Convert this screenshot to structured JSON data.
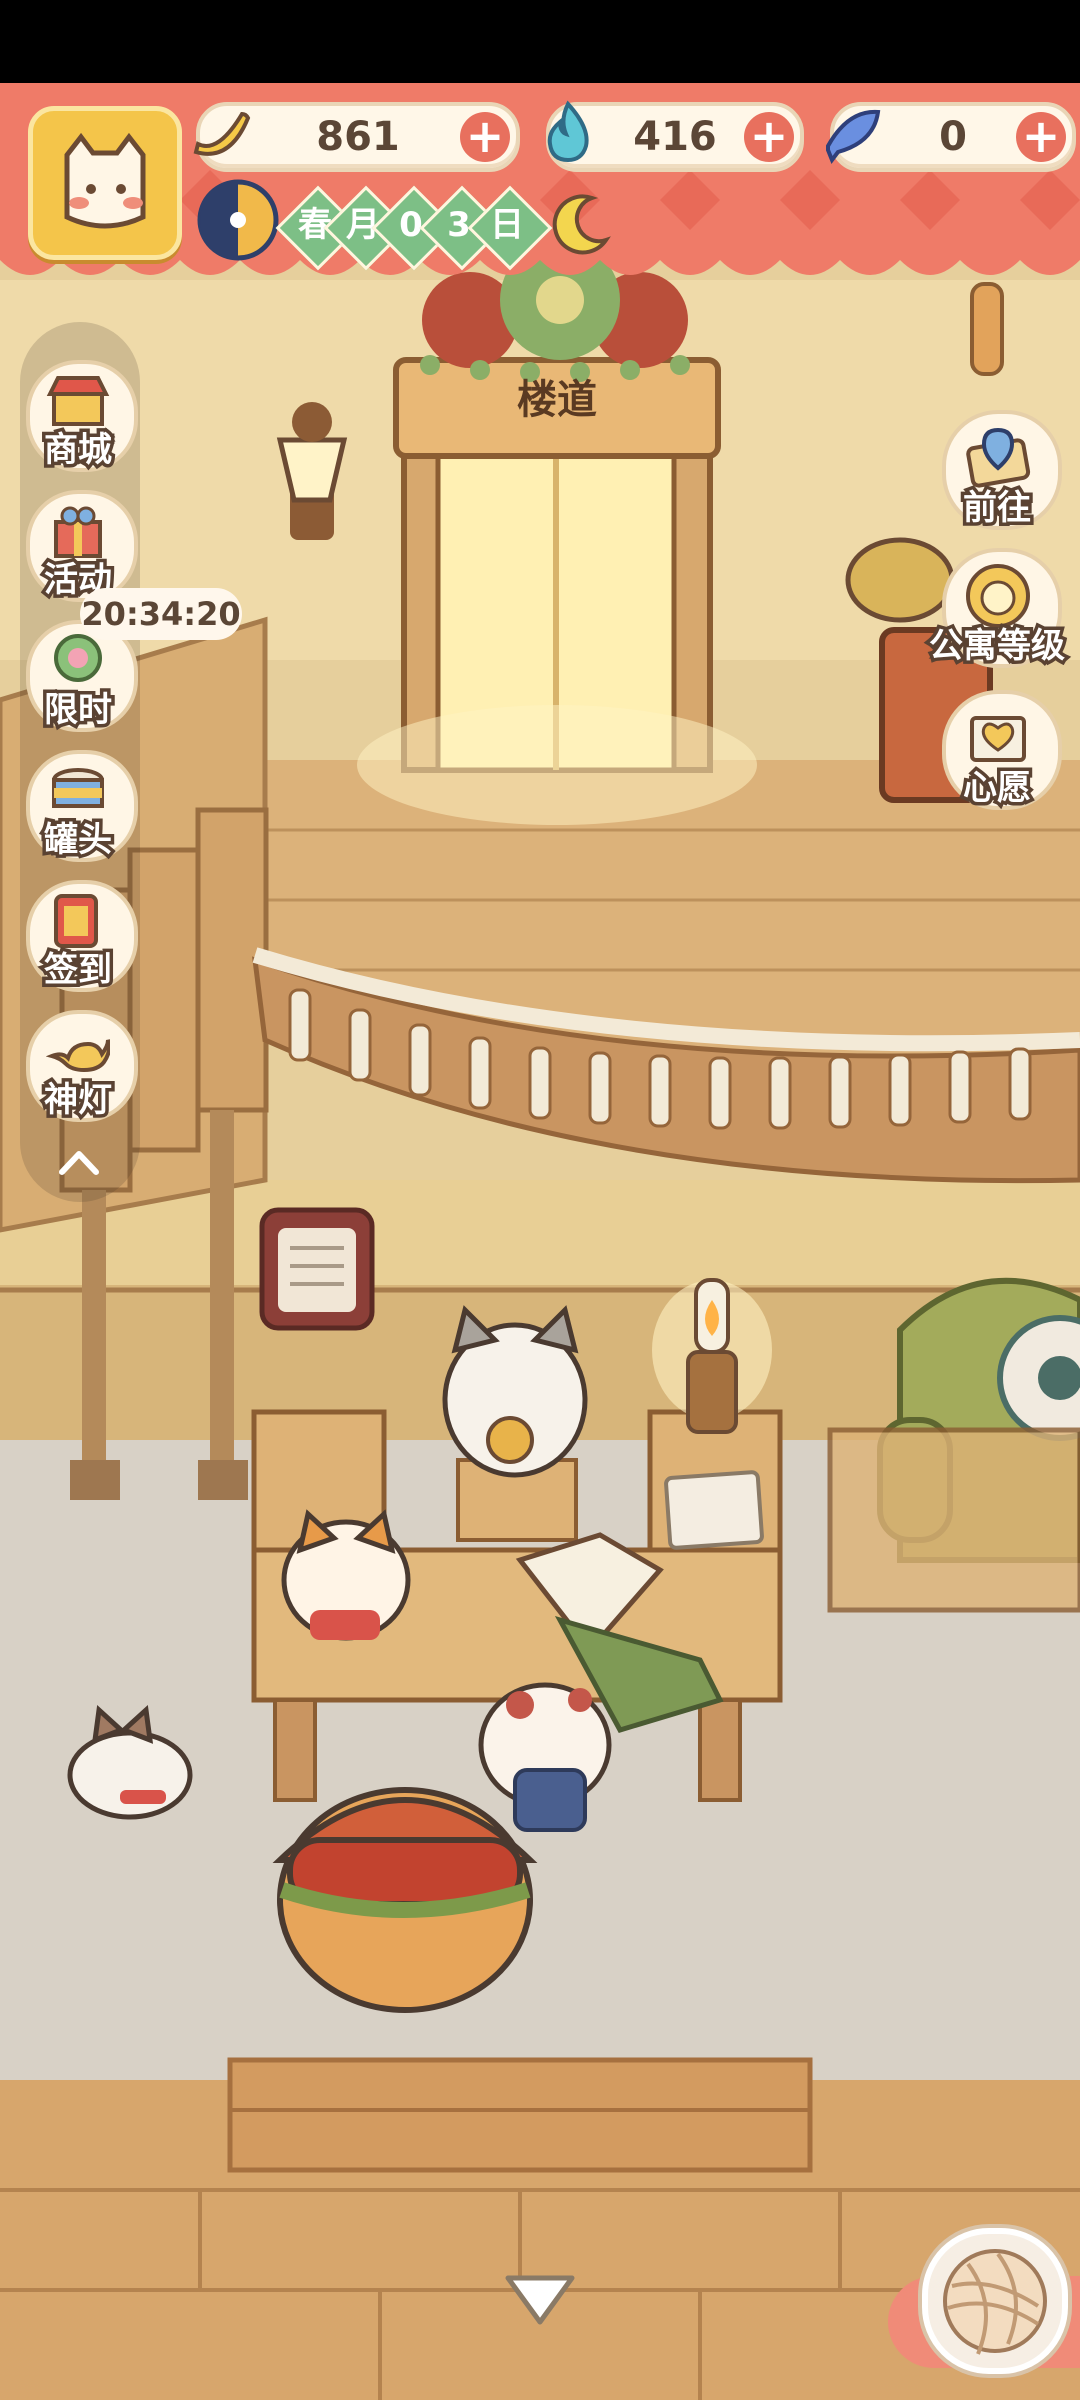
{
  "hud": {
    "currencies": [
      {
        "name": "banana",
        "value": "861",
        "icon": "banana-icon"
      },
      {
        "name": "flame",
        "value": "416",
        "icon": "blue-flame-icon"
      },
      {
        "name": "fish",
        "value": "0",
        "icon": "blue-fish-icon"
      }
    ],
    "date": {
      "chars": [
        "春",
        "月",
        "0",
        "3",
        "日"
      ],
      "icon": "day-night-compass-icon",
      "moon_icon": "sleeping-moon-icon"
    }
  },
  "side_menu": [
    {
      "label": "商城",
      "icon": "shop-icon"
    },
    {
      "label": "活动",
      "icon": "gift-icon"
    },
    {
      "label": "限时",
      "icon": "flower-icon",
      "timer": "20:34:20"
    },
    {
      "label": "罐头",
      "icon": "can-icon"
    },
    {
      "label": "签到",
      "icon": "calendar-icon"
    },
    {
      "label": "神灯",
      "icon": "magic-lamp-icon"
    }
  ],
  "right_menu": [
    {
      "label": "前往",
      "icon": "map-pin-icon"
    },
    {
      "label": "公寓等级",
      "icon": "cat-sun-badge-icon"
    },
    {
      "label": "心愿",
      "icon": "heart-book-icon"
    }
  ],
  "scene": {
    "stair_sign": "楼道"
  },
  "colors": {
    "hud_red": "#ef7b68",
    "wall": "#efd39b",
    "floor": "#d9d2c7"
  }
}
